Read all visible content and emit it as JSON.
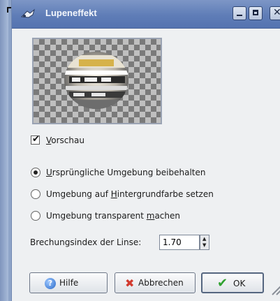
{
  "window": {
    "title": "Lupeneffekt"
  },
  "preview": {
    "checkbox_label": "Vorschau",
    "checked": true
  },
  "surroundings": {
    "options": [
      {
        "label": "Ursprüngliche Umgebung beibehalten",
        "selected": true
      },
      {
        "label": "Umgebung auf Hintergrundfarbe setzen",
        "selected": false
      },
      {
        "label": "Umgebung transparent machen",
        "selected": false
      }
    ]
  },
  "refraction": {
    "label": "Brechungsindex der Linse:",
    "value": "1.70"
  },
  "buttons": {
    "help": "Hilfe",
    "cancel": "Abbrechen",
    "ok": "OK"
  },
  "colors": {
    "titlebar": "#5f7db7",
    "dialog_bg": "#eef0f2",
    "ok_check": "#2fa12f",
    "cancel_x": "#d23b2f"
  },
  "icons": {
    "title": "magnifier-plugin-icon",
    "help": "help-icon",
    "cancel": "cancel-x-icon",
    "ok": "checkmark-icon"
  }
}
